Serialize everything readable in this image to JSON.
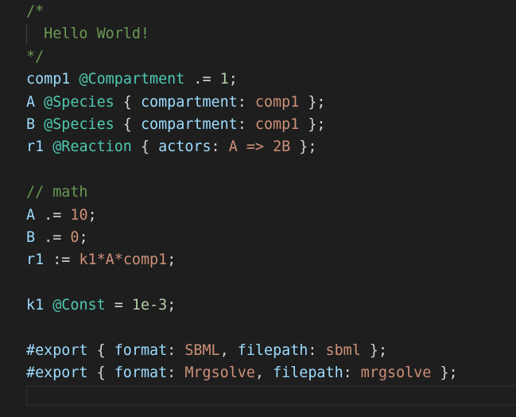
{
  "editor": {
    "theme": "dark",
    "colors": {
      "background": "#1e1e1e",
      "comment": "#6a9955",
      "identifier": "#9cdcfe",
      "type": "#4ec9b0",
      "operator": "#d4d4d4",
      "number": "#b5cea8",
      "string": "#ce9178",
      "indent_guide": "#404040",
      "current_line_border": "#282828"
    },
    "lines": [
      {
        "tokens": [
          {
            "t": "/*",
            "c": "comment"
          }
        ]
      },
      {
        "tokens": [
          {
            "t": "  Hello World!",
            "c": "comment"
          }
        ]
      },
      {
        "tokens": [
          {
            "t": "*/",
            "c": "comment"
          }
        ]
      },
      {
        "tokens": [
          {
            "t": "comp1",
            "c": "ident"
          },
          {
            "t": " ",
            "c": "op"
          },
          {
            "t": "@Compartment",
            "c": "type"
          },
          {
            "t": " .= ",
            "c": "op"
          },
          {
            "t": "1",
            "c": "num"
          },
          {
            "t": ";",
            "c": "op"
          }
        ]
      },
      {
        "tokens": [
          {
            "t": "A",
            "c": "ident"
          },
          {
            "t": " ",
            "c": "op"
          },
          {
            "t": "@Species",
            "c": "type"
          },
          {
            "t": " { ",
            "c": "op"
          },
          {
            "t": "compartment",
            "c": "ident"
          },
          {
            "t": ": ",
            "c": "op"
          },
          {
            "t": "comp1",
            "c": "str"
          },
          {
            "t": " };",
            "c": "op"
          }
        ]
      },
      {
        "tokens": [
          {
            "t": "B",
            "c": "ident"
          },
          {
            "t": " ",
            "c": "op"
          },
          {
            "t": "@Species",
            "c": "type"
          },
          {
            "t": " { ",
            "c": "op"
          },
          {
            "t": "compartment",
            "c": "ident"
          },
          {
            "t": ": ",
            "c": "op"
          },
          {
            "t": "comp1",
            "c": "str"
          },
          {
            "t": " };",
            "c": "op"
          }
        ]
      },
      {
        "tokens": [
          {
            "t": "r1",
            "c": "ident"
          },
          {
            "t": " ",
            "c": "op"
          },
          {
            "t": "@Reaction",
            "c": "type"
          },
          {
            "t": " { ",
            "c": "op"
          },
          {
            "t": "actors",
            "c": "ident"
          },
          {
            "t": ": ",
            "c": "op"
          },
          {
            "t": "A => 2B",
            "c": "str"
          },
          {
            "t": " };",
            "c": "op"
          }
        ]
      },
      {
        "tokens": []
      },
      {
        "tokens": [
          {
            "t": "// math",
            "c": "comment"
          }
        ]
      },
      {
        "tokens": [
          {
            "t": "A",
            "c": "ident"
          },
          {
            "t": " .= ",
            "c": "op"
          },
          {
            "t": "10",
            "c": "str"
          },
          {
            "t": ";",
            "c": "op"
          }
        ]
      },
      {
        "tokens": [
          {
            "t": "B",
            "c": "ident"
          },
          {
            "t": " .= ",
            "c": "op"
          },
          {
            "t": "0",
            "c": "str"
          },
          {
            "t": ";",
            "c": "op"
          }
        ]
      },
      {
        "tokens": [
          {
            "t": "r1",
            "c": "ident"
          },
          {
            "t": " := ",
            "c": "op"
          },
          {
            "t": "k1*A*comp1",
            "c": "str"
          },
          {
            "t": ";",
            "c": "op"
          }
        ]
      },
      {
        "tokens": []
      },
      {
        "tokens": [
          {
            "t": "k1",
            "c": "ident"
          },
          {
            "t": " ",
            "c": "op"
          },
          {
            "t": "@Const",
            "c": "type"
          },
          {
            "t": " = ",
            "c": "op"
          },
          {
            "t": "1e-3",
            "c": "num"
          },
          {
            "t": ";",
            "c": "op"
          }
        ]
      },
      {
        "tokens": []
      },
      {
        "tokens": [
          {
            "t": "#export",
            "c": "ident"
          },
          {
            "t": " { ",
            "c": "op"
          },
          {
            "t": "format",
            "c": "ident"
          },
          {
            "t": ": ",
            "c": "op"
          },
          {
            "t": "SBML",
            "c": "str"
          },
          {
            "t": ", ",
            "c": "op"
          },
          {
            "t": "filepath",
            "c": "ident"
          },
          {
            "t": ": ",
            "c": "op"
          },
          {
            "t": "sbml",
            "c": "str"
          },
          {
            "t": " };",
            "c": "op"
          }
        ]
      },
      {
        "tokens": [
          {
            "t": "#export",
            "c": "ident"
          },
          {
            "t": " { ",
            "c": "op"
          },
          {
            "t": "format",
            "c": "ident"
          },
          {
            "t": ": ",
            "c": "op"
          },
          {
            "t": "Mrgsolve",
            "c": "str"
          },
          {
            "t": ", ",
            "c": "op"
          },
          {
            "t": "filepath",
            "c": "ident"
          },
          {
            "t": ": ",
            "c": "op"
          },
          {
            "t": "mrgsolve",
            "c": "str"
          },
          {
            "t": " };",
            "c": "op"
          }
        ]
      },
      {
        "tokens": []
      }
    ]
  }
}
